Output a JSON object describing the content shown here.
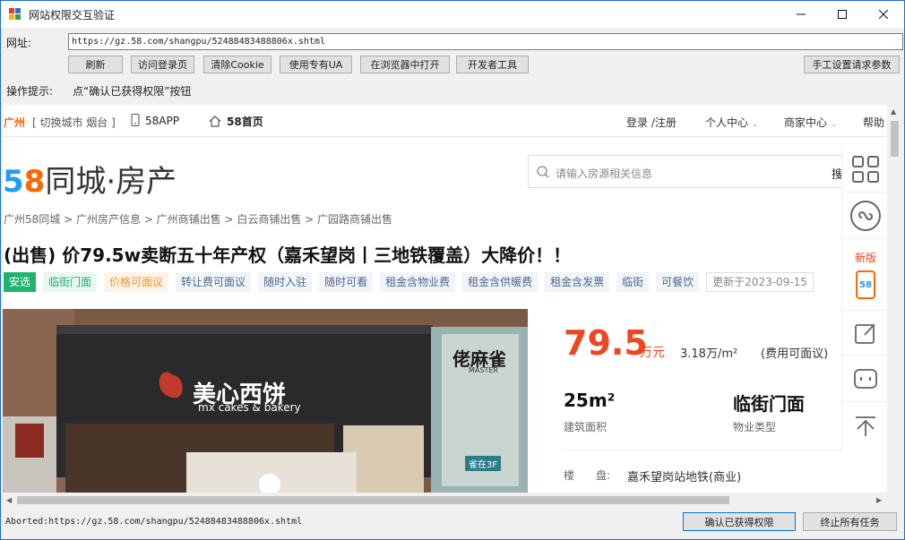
{
  "window": {
    "title": "网站权限交互验证",
    "minimize_icon": "minimize-icon",
    "maximize_icon": "maximize-icon",
    "close_icon": "close-icon"
  },
  "address": {
    "label": "网址:",
    "value": "https://gz.58.com/shangpu/52488483488806x.shtml"
  },
  "toolbar": {
    "refresh": "刷新",
    "visit_login": "访问登录页",
    "clear_cookie": "清除Cookie",
    "use_ua": "使用专有UA",
    "open_browser": "在浏览器中打开",
    "devtools": "开发者工具",
    "manual_params": "手工设置请求参数"
  },
  "tip": {
    "label": "操作提示:",
    "text": "点“确认已获得权限”按钮"
  },
  "web": {
    "city": "广州",
    "switch_city": "[ 切换城市  烟台 ]",
    "app_link": "58APP",
    "home_link": "58首页",
    "login": "登录 /注册",
    "personal_center": "个人中心",
    "merchant_center": "商家中心",
    "help": "帮助",
    "logo_5": "5",
    "logo_8": "8",
    "logo_rest": "同城·房产",
    "search_placeholder": "请输入房源相关信息",
    "search_button": "搜",
    "breadcrumb": "广州58同城 > 广州房产信息 > 广州商铺出售 > 白云商铺出售 > 广园路商铺出售",
    "headline": "(出售) 价79.5w卖断五十年产权（嘉禾望岗丨三地铁覆盖）大降价！！",
    "tags": [
      "安选",
      "临街门面",
      "价格可面议",
      "转让费可面议",
      "随时入驻",
      "随时可看",
      "租金含物业费",
      "租金含供暖费",
      "租金含发票",
      "临街",
      "可餐饮",
      "更新于2023-09-15"
    ],
    "photo": {
      "shop_name_cn": "美心西饼",
      "shop_name_en": "mx cakes & bakery",
      "side_sign": "佬麻雀",
      "side_sign_en": "MASTER",
      "floor_label": "雀在3F"
    },
    "price": "79.5",
    "price_unit": "万元",
    "unit_price": "3.18万/m²",
    "fee_note": "(费用可面议)",
    "area_value": "25m²",
    "area_label": "建筑面积",
    "type_value": "临街门面",
    "type_label": "物业类型",
    "building_label": "楼　　盘:",
    "building_value": "嘉禾望岗站地铁(商业)",
    "sidebar_new": "新版",
    "sidebar_58": "58"
  },
  "status": {
    "text": "Aborted:https://gz.58.com/shangpu/52488483488806x.shtml",
    "confirm": "确认已获得权限",
    "stop_all": "终止所有任务"
  },
  "colors": {
    "accent": "#f3431f",
    "orange": "#ff6600",
    "green": "#1fb46d",
    "blue": "#1e9bff"
  }
}
